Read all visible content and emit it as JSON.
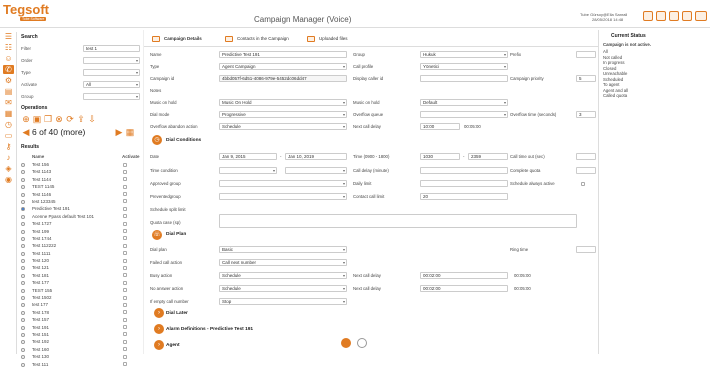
{
  "header": {
    "logo": "Tegsoft",
    "logo_sub": "Tobe Software",
    "title": "Campaign Manager (Voice)",
    "user": "Tube Gürsoy@Ella Sanrall",
    "datetime": "28/05/2018 14:48"
  },
  "search": {
    "heading": "Search",
    "filter_label": "Filter",
    "filter_value": "test 1",
    "order_label": "Order",
    "order_value": "",
    "type_label": "Type",
    "type_value": "",
    "activate_label": "Activate",
    "activate_value": "All",
    "group_label": "Group",
    "group_value": ""
  },
  "operations": {
    "heading": "Operations",
    "pager": "6 of 40 (more)"
  },
  "results": {
    "heading": "Results",
    "col_name": "Name",
    "col_active": "Activate",
    "items": [
      "Test 156",
      "Test 1143",
      "Test 1144",
      "TEST 1145",
      "Test 1146",
      "test 123345",
      "Predictive Test 191",
      "Acenne Ppass default Test 101",
      "Test 1727",
      "Test 199",
      "Test 1744",
      "Test 112222",
      "Test 1111",
      "Test 120",
      "Test 121",
      "Test 181",
      "Test 177",
      "TEST 155",
      "Test 1502",
      "test 177",
      "Test 178",
      "Test 157",
      "Test 191",
      "Test 151",
      "Test 192",
      "Test 160",
      "Test 130",
      "Test 111"
    ],
    "selected_index": 6
  },
  "tabs": [
    {
      "label": "Campaign Details"
    },
    {
      "label": "Contacts in the Campaign"
    },
    {
      "label": "Uploaded files"
    }
  ],
  "form": {
    "name_l": "Name",
    "name_v": "Predictive Test 191",
    "type_l": "Type",
    "type_v": "Agent Campaign",
    "cid_l": "Campaign id",
    "cid_v": "4bbd057f-6d51-4086-979e-5452dc06dd47",
    "notes_l": "Notes",
    "moh_l": "Music on hold",
    "moh_v": "Music On Hold",
    "dial_l": "Dial mode",
    "dial_v": "Progressive",
    "oaa_l": "Overflow abandon action",
    "oaa_v": "Schedule",
    "group_l": "Group",
    "group_v": "Hukuk",
    "cprof_l": "Call profile",
    "cprof_v": "Yönetici",
    "disp_l": "Display caller id",
    "moh2_l": "Music on hold",
    "moh2_v": "Default",
    "oq_l": "Overflow queue",
    "ncd_l": "Next call delay",
    "ncd_v": "10:00",
    "ncd_v2": "00:05:00",
    "prefix_l": "Prefix",
    "prio_l": "Campaign priority",
    "prio_v": "5",
    "ot_l": "Overflow time (seconds)",
    "ot_v": "3"
  },
  "dial_conditions": {
    "heading": "Dial Conditions",
    "date_l": "Date",
    "date_from": "Jan 9, 2015",
    "date_to": "Jan 10, 2019",
    "tc_l": "Time condition",
    "ag_l": "Approved group",
    "pg_l": "Preventedgroup",
    "sl_l": "Schedule split limit",
    "qcase_l": "Quota case (sp)",
    "time_l": "Time (0900 - 1800)",
    "time_from": "1030",
    "time_to": "2359",
    "cdm_l": "Call delay (minute)",
    "dl_l": "Daily limit",
    "ccl_l": "Contact call limit",
    "ccl_v": "20",
    "cto_l": "Call time out (sec)",
    "cq_l": "Complete quota",
    "saa_l": "Schedule always active"
  },
  "dial_plan": {
    "heading": "Dial Plan",
    "dp_l": "Dial plan",
    "dp_v": "Basic",
    "fca_l": "Failed call action",
    "fca_v": "Call next number",
    "ba_l": "Busy action",
    "ba_v": "Schedule",
    "na_l": "No answer action",
    "na_v": "Schedule",
    "iec_l": "If empty call number",
    "iec_v": "Stop",
    "ncd_l": "Next call delay",
    "ncd1": "00:02:00",
    "ncd1b": "00:05:00",
    "ncd2_l": "Next call delay",
    "ncd2": "00:02:00",
    "ncd2b": "00:05:00",
    "rt_l": "Ring time"
  },
  "sections": {
    "dial_later": "Dial Later",
    "alarm": "Alarm Definitions - Predictive Test 191",
    "agent": "Agent"
  },
  "status": {
    "heading": "Current Status",
    "not_active": "Campaign is not active.",
    "rows": [
      "All",
      "Not called",
      "In progress",
      "Closed",
      "Unreachable",
      "Scheduled",
      "To agent",
      "Agent and all",
      "Called quota"
    ]
  },
  "colors": {
    "accent": "#e07b22"
  }
}
